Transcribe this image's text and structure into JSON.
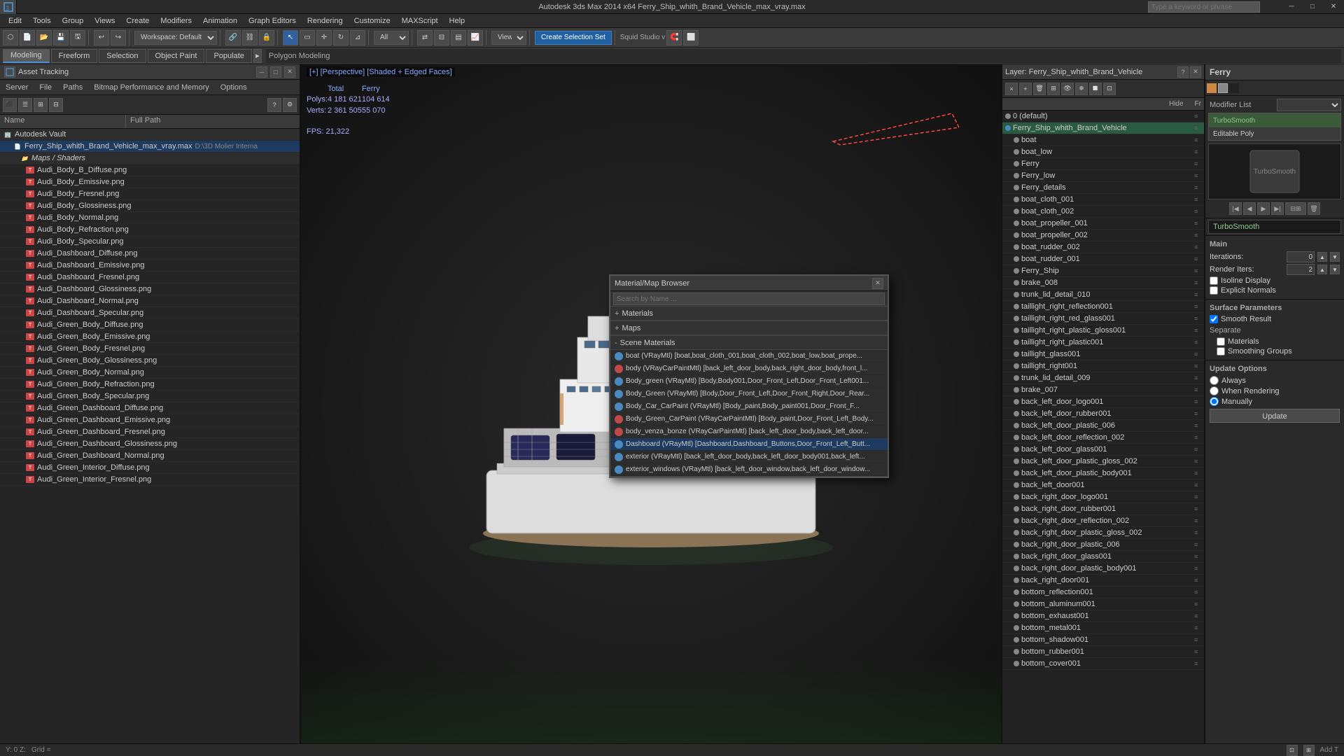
{
  "app": {
    "title": "Autodesk 3ds Max 2014 x64  Ferry_Ship_whith_Brand_Vehicle_max_vray.max",
    "search_placeholder": "Type a keyword or phrase"
  },
  "menu": {
    "items": [
      "Edit",
      "Tools",
      "Group",
      "Views",
      "Create",
      "Modifiers",
      "Animation",
      "Graph Editors",
      "Rendering",
      "Customize",
      "MAXScript",
      "Help"
    ]
  },
  "toolbar": {
    "workspace_label": "Workspace: Default",
    "squid_label": "Squid Studio v",
    "create_selection_label": "Create Selection Set"
  },
  "tabs": {
    "modeling": "Modeling",
    "freeform": "Freeform",
    "selection": "Selection",
    "object_paint": "Object Paint",
    "populate": "Populate",
    "sub": "Polygon Modeling"
  },
  "viewport": {
    "label": "[+] [Perspective] [Shaded + Edged Faces]",
    "stats_total": "Total",
    "stats_ferry": "Ferry",
    "polys_total": "4 181 621",
    "polys_ferry": "104 614",
    "verts_total": "2 361 505",
    "verts_ferry": "55 070",
    "fps_label": "FPS:",
    "fps_value": "21,322"
  },
  "asset_tracking": {
    "title": "Asset Tracking",
    "menus": [
      "Server",
      "File",
      "Paths",
      "Bitmap Performance and Memory",
      "Options"
    ],
    "col_name": "Name",
    "col_path": "Full Path",
    "items": [
      {
        "level": 0,
        "type": "root",
        "name": "Autodesk Vault",
        "path": ""
      },
      {
        "level": 1,
        "type": "file",
        "name": "Ferry_Ship_whith_Brand_Vehicle_max_vray.max",
        "path": "D:\\3D Molier Interna"
      },
      {
        "level": 2,
        "type": "group",
        "name": "Maps / Shaders",
        "path": ""
      },
      {
        "level": 3,
        "type": "png",
        "name": "Audi_Body_B_Diffuse.png",
        "path": ""
      },
      {
        "level": 3,
        "type": "png",
        "name": "Audi_Body_Emissive.png",
        "path": ""
      },
      {
        "level": 3,
        "type": "png",
        "name": "Audi_Body_Fresnel.png",
        "path": ""
      },
      {
        "level": 3,
        "type": "png",
        "name": "Audi_Body_Glossiness.png",
        "path": ""
      },
      {
        "level": 3,
        "type": "png",
        "name": "Audi_Body_Normal.png",
        "path": ""
      },
      {
        "level": 3,
        "type": "png",
        "name": "Audi_Body_Refraction.png",
        "path": ""
      },
      {
        "level": 3,
        "type": "png",
        "name": "Audi_Body_Specular.png",
        "path": ""
      },
      {
        "level": 3,
        "type": "png",
        "name": "Audi_Dashboard_Diffuse.png",
        "path": ""
      },
      {
        "level": 3,
        "type": "png",
        "name": "Audi_Dashboard_Emissive.png",
        "path": ""
      },
      {
        "level": 3,
        "type": "png",
        "name": "Audi_Dashboard_Fresnel.png",
        "path": ""
      },
      {
        "level": 3,
        "type": "png",
        "name": "Audi_Dashboard_Glossiness.png",
        "path": ""
      },
      {
        "level": 3,
        "type": "png",
        "name": "Audi_Dashboard_Normal.png",
        "path": ""
      },
      {
        "level": 3,
        "type": "png",
        "name": "Audi_Dashboard_Specular.png",
        "path": ""
      },
      {
        "level": 3,
        "type": "png",
        "name": "Audi_Green_Body_Diffuse.png",
        "path": ""
      },
      {
        "level": 3,
        "type": "png",
        "name": "Audi_Green_Body_Emissive.png",
        "path": ""
      },
      {
        "level": 3,
        "type": "png",
        "name": "Audi_Green_Body_Fresnel.png",
        "path": ""
      },
      {
        "level": 3,
        "type": "png",
        "name": "Audi_Green_Body_Glossiness.png",
        "path": ""
      },
      {
        "level": 3,
        "type": "png",
        "name": "Audi_Green_Body_Normal.png",
        "path": ""
      },
      {
        "level": 3,
        "type": "png",
        "name": "Audi_Green_Body_Refraction.png",
        "path": ""
      },
      {
        "level": 3,
        "type": "png",
        "name": "Audi_Green_Body_Specular.png",
        "path": ""
      },
      {
        "level": 3,
        "type": "png",
        "name": "Audi_Green_Dashboard_Diffuse.png",
        "path": ""
      },
      {
        "level": 3,
        "type": "png",
        "name": "Audi_Green_Dashboard_Emissive.png",
        "path": ""
      },
      {
        "level": 3,
        "type": "png",
        "name": "Audi_Green_Dashboard_Fresnel.png",
        "path": ""
      },
      {
        "level": 3,
        "type": "png",
        "name": "Audi_Green_Dashboard_Glossiness.png",
        "path": ""
      },
      {
        "level": 3,
        "type": "png",
        "name": "Audi_Green_Dashboard_Normal.png",
        "path": ""
      },
      {
        "level": 3,
        "type": "png",
        "name": "Audi_Green_Interior_Diffuse.png",
        "path": ""
      },
      {
        "level": 3,
        "type": "png",
        "name": "Audi_Green_Interior_Fresnel.png",
        "path": ""
      }
    ]
  },
  "layers": {
    "panel_title": "Layer: Ferry_Ship_whith_Brand_Vehicle",
    "col_hide": "Hide",
    "col_fr": "Fr",
    "items": [
      {
        "name": "0 (default)",
        "level": 0,
        "active": false,
        "color": "#888"
      },
      {
        "name": "Ferry_Ship_whith_Brand_Vehicle",
        "level": 1,
        "active": true,
        "color": "#4a8ac0"
      },
      {
        "name": "boat",
        "level": 2,
        "active": false,
        "color": "#888"
      },
      {
        "name": "boat_low",
        "level": 2,
        "active": false,
        "color": "#888"
      },
      {
        "name": "Ferry",
        "level": 2,
        "active": false,
        "color": "#888"
      },
      {
        "name": "Ferry_low",
        "level": 2,
        "active": false,
        "color": "#888"
      },
      {
        "name": "Ferry_details",
        "level": 2,
        "active": false,
        "color": "#888"
      },
      {
        "name": "boat_cloth_001",
        "level": 2,
        "active": false,
        "color": "#888"
      },
      {
        "name": "boat_cloth_002",
        "level": 2,
        "active": false,
        "color": "#888"
      },
      {
        "name": "boat_propeller_001",
        "level": 2,
        "active": false,
        "color": "#888"
      },
      {
        "name": "boat_propeller_002",
        "level": 2,
        "active": false,
        "color": "#888"
      },
      {
        "name": "boat_rudder_002",
        "level": 2,
        "active": false,
        "color": "#888"
      },
      {
        "name": "boat_rudder_001",
        "level": 2,
        "active": false,
        "color": "#888"
      },
      {
        "name": "Ferry_Ship",
        "level": 2,
        "active": false,
        "color": "#888"
      },
      {
        "name": "brake_008",
        "level": 2,
        "active": false,
        "color": "#888"
      },
      {
        "name": "trunk_lid_detail_010",
        "level": 2,
        "active": false,
        "color": "#888"
      },
      {
        "name": "taillight_right_reflection001",
        "level": 2,
        "active": false,
        "color": "#888"
      },
      {
        "name": "taillight_right_red_glass001",
        "level": 2,
        "active": false,
        "color": "#888"
      },
      {
        "name": "taillight_right_plastic_gloss001",
        "level": 2,
        "active": false,
        "color": "#888"
      },
      {
        "name": "taillight_right_plastic001",
        "level": 2,
        "active": false,
        "color": "#888"
      },
      {
        "name": "taillight_glass001",
        "level": 2,
        "active": false,
        "color": "#888"
      },
      {
        "name": "taillight_right001",
        "level": 2,
        "active": false,
        "color": "#888"
      },
      {
        "name": "trunk_lid_detail_009",
        "level": 2,
        "active": false,
        "color": "#888"
      },
      {
        "name": "brake_007",
        "level": 2,
        "active": false,
        "color": "#888"
      },
      {
        "name": "back_left_door_logo001",
        "level": 2,
        "active": false,
        "color": "#888"
      },
      {
        "name": "back_left_door_rubber001",
        "level": 2,
        "active": false,
        "color": "#888"
      },
      {
        "name": "back_left_door_plastic_006",
        "level": 2,
        "active": false,
        "color": "#888"
      },
      {
        "name": "back_left_door_reflection_002",
        "level": 2,
        "active": false,
        "color": "#888"
      },
      {
        "name": "back_left_door_glass001",
        "level": 2,
        "active": false,
        "color": "#888"
      },
      {
        "name": "back_left_door_plastic_gloss_002",
        "level": 2,
        "active": false,
        "color": "#888"
      },
      {
        "name": "back_left_door_plastic_body001",
        "level": 2,
        "active": false,
        "color": "#888"
      },
      {
        "name": "back_left_door001",
        "level": 2,
        "active": false,
        "color": "#888"
      },
      {
        "name": "back_right_door_logo001",
        "level": 2,
        "active": false,
        "color": "#888"
      },
      {
        "name": "back_right_door_rubber001",
        "level": 2,
        "active": false,
        "color": "#888"
      },
      {
        "name": "back_right_door_reflection_002",
        "level": 2,
        "active": false,
        "color": "#888"
      },
      {
        "name": "back_right_door_plastic_gloss_002",
        "level": 2,
        "active": false,
        "color": "#888"
      },
      {
        "name": "back_right_door_plastic_006",
        "level": 2,
        "active": false,
        "color": "#888"
      },
      {
        "name": "back_right_door_glass001",
        "level": 2,
        "active": false,
        "color": "#888"
      },
      {
        "name": "back_right_door_plastic_body001",
        "level": 2,
        "active": false,
        "color": "#888"
      },
      {
        "name": "back_right_door001",
        "level": 2,
        "active": false,
        "color": "#888"
      },
      {
        "name": "bottom_reflection001",
        "level": 2,
        "active": false,
        "color": "#888"
      },
      {
        "name": "bottom_aluminum001",
        "level": 2,
        "active": false,
        "color": "#888"
      },
      {
        "name": "bottom_exhaust001",
        "level": 2,
        "active": false,
        "color": "#888"
      },
      {
        "name": "bottom_metal001",
        "level": 2,
        "active": false,
        "color": "#888"
      },
      {
        "name": "bottom_shadow001",
        "level": 2,
        "active": false,
        "color": "#888"
      },
      {
        "name": "bottom_rubber001",
        "level": 2,
        "active": false,
        "color": "#888"
      },
      {
        "name": "bottom_cover001",
        "level": 2,
        "active": false,
        "color": "#888"
      }
    ]
  },
  "modifier": {
    "title": "Ferry",
    "modifier_list_label": "Modifier List",
    "turbosmoothLabel": "TurboSmooth",
    "editable_poly": "Editable Poly",
    "params": {
      "title": "TurboSmooth",
      "main_label": "Main",
      "iterations_label": "Iterations:",
      "iterations_value": "0",
      "render_iters_label": "Render Iters:",
      "render_iters_value": "2",
      "isoline_label": "Isoline Display",
      "explicit_normals_label": "Explicit Normals",
      "surface_params_label": "Surface Parameters",
      "smooth_result_label": "Smooth Result",
      "separate_label": "Separate",
      "materials_label": "Materials",
      "smoothing_groups_label": "Smoothing Groups",
      "update_options_label": "Update Options",
      "always_label": "Always",
      "when_rendering_label": "When Rendering",
      "manually_label": "Manually",
      "update_btn": "Update"
    }
  },
  "material_browser": {
    "title": "Material/Map Browser",
    "search_placeholder": "Search by Name ...",
    "sections": {
      "materials": "Materials",
      "maps": "Maps",
      "scene_materials": "Scene Materials"
    },
    "scene_items": [
      {
        "name": "boat (VRayMtl) [boat,boat_cloth_001,boat_cloth_002,boat_low,boat_prope...",
        "type": "vray"
      },
      {
        "name": "body (VRayCarPaintMtl) [back_left_door_body,back_right_door_body,front_l...",
        "type": "car"
      },
      {
        "name": "Body_green (VRayMtl) [Body,Body001,Door_Front_Left,Door_Front_Left001...",
        "type": "vray"
      },
      {
        "name": "Body_Green (VRayMtl) [Body,Door_Front_Left,Door_Front_Right,Door_Rear...",
        "type": "vray"
      },
      {
        "name": "Body_Car_CarPaint (VRayMtl) [Body_paint,Body_paint001,Door_Front_F...",
        "type": "vray"
      },
      {
        "name": "Body_Green_CarPaint (VRayCarPaintMtl) [Body_paint,Door_Front_Left_Body...",
        "type": "car"
      },
      {
        "name": "body_venza_bonze (VRayCarPaintMtl) [back_left_door_body,back_left_door...",
        "type": "car"
      },
      {
        "name": "Dashboard (VRayMtl) [Dashboard,Dashboard_Buttons,Door_Front_Left_Butt...",
        "type": "vray",
        "selected": true
      },
      {
        "name": "exterior (VRayMtl) [back_left_door_body,back_left_door_body001,back_left...",
        "type": "vray"
      },
      {
        "name": "exterior_windows (VRayMtl) [back_left_door_window,back_left_door_window...",
        "type": "vray"
      }
    ]
  },
  "status_bar": {
    "coords": "Y: 0   Z:",
    "grid": "Grid =",
    "add_t": "Add T"
  }
}
